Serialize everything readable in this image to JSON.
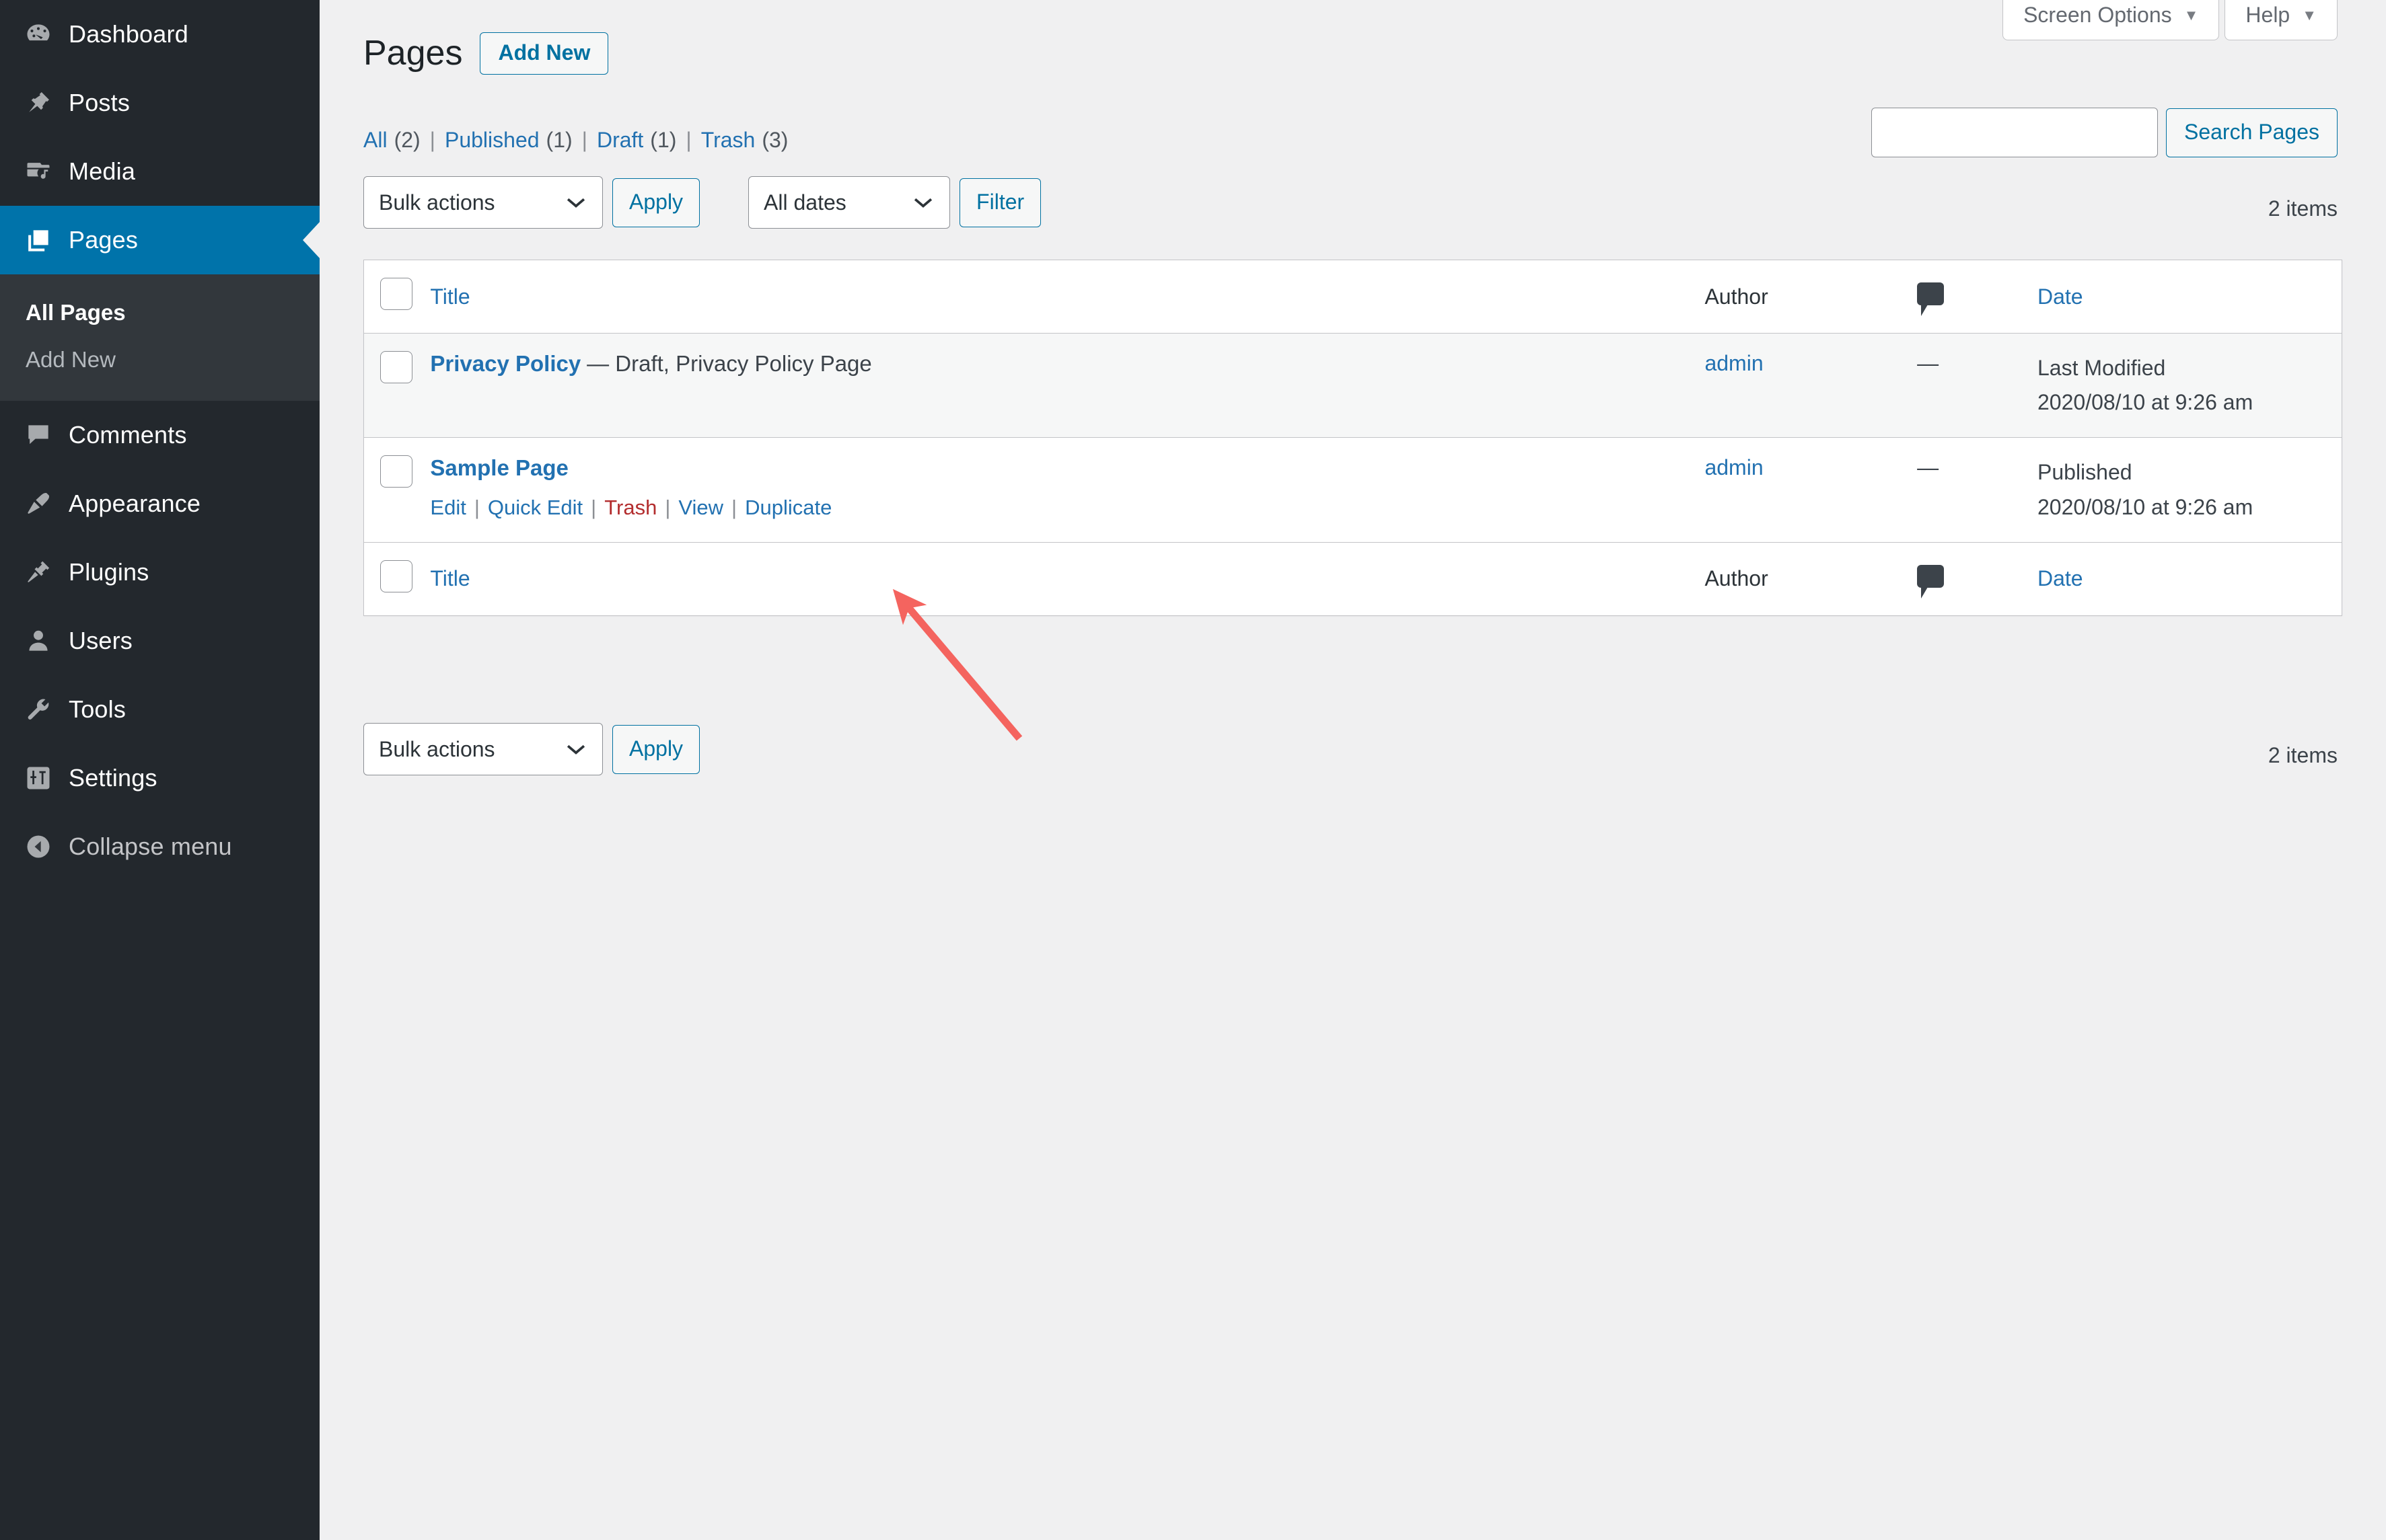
{
  "sidebar": {
    "items": [
      {
        "label": "Dashboard",
        "icon": "dashboard-icon",
        "current": false
      },
      {
        "label": "Posts",
        "icon": "pin-icon",
        "current": false
      },
      {
        "label": "Media",
        "icon": "media-icon",
        "current": false
      },
      {
        "label": "Pages",
        "icon": "pages-icon",
        "current": true
      },
      {
        "label": "Comments",
        "icon": "comments-icon",
        "current": false
      },
      {
        "label": "Appearance",
        "icon": "brush-icon",
        "current": false
      },
      {
        "label": "Plugins",
        "icon": "plugin-icon",
        "current": false
      },
      {
        "label": "Users",
        "icon": "users-icon",
        "current": false
      },
      {
        "label": "Tools",
        "icon": "wrench-icon",
        "current": false
      },
      {
        "label": "Settings",
        "icon": "settings-icon",
        "current": false
      }
    ],
    "submenu": [
      {
        "label": "All Pages",
        "current": true
      },
      {
        "label": "Add New",
        "current": false
      }
    ],
    "collapse": {
      "label": "Collapse menu",
      "icon": "collapse-arrow-icon"
    }
  },
  "screen_meta": {
    "screen_options": "Screen Options",
    "help": "Help",
    "caret": "▼"
  },
  "header": {
    "title": "Pages",
    "add_new": "Add New"
  },
  "search": {
    "value": "",
    "placeholder": "",
    "submit": "Search Pages"
  },
  "views": [
    {
      "label": "All",
      "count": "(2)"
    },
    {
      "label": "Published",
      "count": "(1)"
    },
    {
      "label": "Draft",
      "count": "(1)"
    },
    {
      "label": "Trash",
      "count": "(3)"
    }
  ],
  "views_separator": "|",
  "tablenav": {
    "bulk_actions_label": "Bulk actions",
    "apply_label": "Apply",
    "all_dates_label": "All dates",
    "filter_label": "Filter",
    "displaying_num_top": "2 items",
    "displaying_num_bottom": "2 items",
    "chevron": "⌄"
  },
  "table": {
    "columns": {
      "title": "Title",
      "author": "Author",
      "comments": "comment-bubble-icon",
      "date": "Date"
    },
    "rows": [
      {
        "title": "Privacy Policy",
        "state": "— Draft, Privacy Policy Page",
        "author": "admin",
        "comments": "—",
        "date_status": "Last Modified",
        "date_value": "2020/08/10 at 9:26 am",
        "actions": []
      },
      {
        "title": "Sample Page",
        "state": "",
        "author": "admin",
        "comments": "—",
        "date_status": "Published",
        "date_value": "2020/08/10 at 9:26 am",
        "actions": [
          {
            "label": "Edit",
            "kind": "edit"
          },
          {
            "label": "Quick Edit",
            "kind": "inline"
          },
          {
            "label": "Trash",
            "kind": "trash"
          },
          {
            "label": "View",
            "kind": "view"
          },
          {
            "label": "Duplicate",
            "kind": "duplicate"
          }
        ],
        "action_divider": "|"
      }
    ]
  },
  "annotation": {
    "arrow_color": "#f4645f",
    "points_at": "Duplicate"
  },
  "colors": {
    "sidebar_bg": "#23282d",
    "submenu_bg": "#32373c",
    "accent_blue": "#0073aa",
    "link_blue": "#2271b1",
    "trash_red": "#b32d2e",
    "page_bg": "#f0f0f1"
  }
}
